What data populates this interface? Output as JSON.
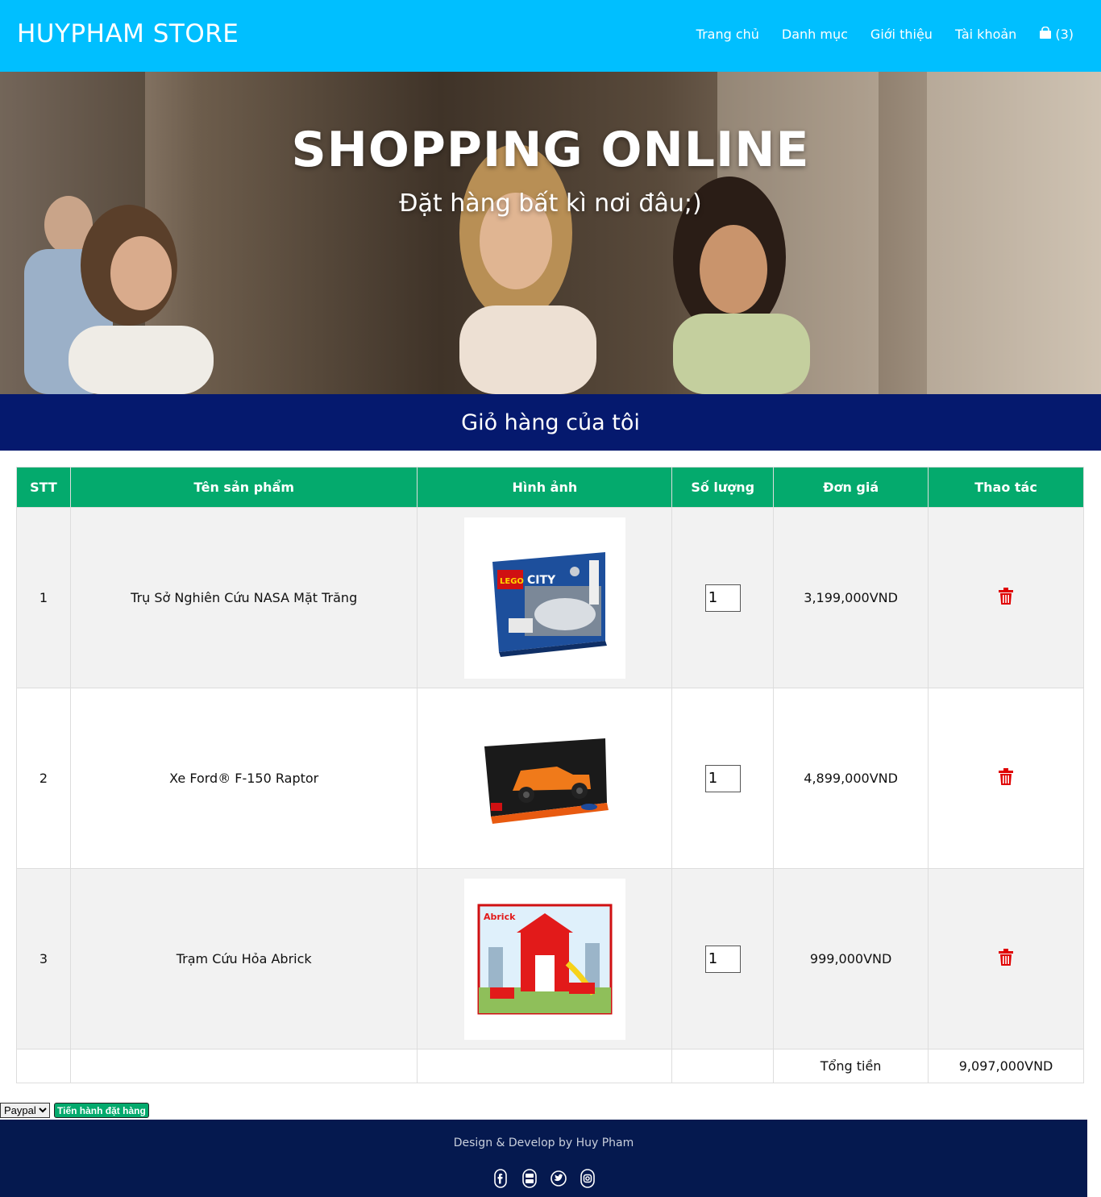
{
  "header": {
    "brand": "HUYPHAM STORE",
    "nav": [
      "Trang chủ",
      "Danh mục",
      "Giới thiệu",
      "Tài khoản"
    ],
    "cart_count": "(3)"
  },
  "hero": {
    "title": "SHOPPING ONLINE",
    "subtitle": "Đặt hàng bất kì nơi đâu;)"
  },
  "cart": {
    "heading": "Giỏ hàng của tôi",
    "columns": [
      "STT",
      "Tên sản phẩm",
      "Hình ảnh",
      "Số lượng",
      "Đơn giá",
      "Thao tác"
    ],
    "items": [
      {
        "stt": "1",
        "name": "Trụ Sở Nghiên Cứu NASA Mặt Trăng",
        "qty": "1",
        "price": "3,199,000VND",
        "image_icon": "lego-city-box-icon"
      },
      {
        "stt": "2",
        "name": "Xe Ford® F-150 Raptor",
        "qty": "1",
        "price": "4,899,000VND",
        "image_icon": "lego-technic-truck-box-icon"
      },
      {
        "stt": "3",
        "name": "Trạm Cứu Hỏa Abrick",
        "qty": "1",
        "price": "999,000VND",
        "image_icon": "abrick-fire-station-box-icon"
      }
    ],
    "total_label": "Tổng tiền",
    "total_value": "9,097,000VND"
  },
  "checkout": {
    "payment_selected": "Paypal",
    "submit_label": "Tiến hành đặt hàng"
  },
  "footer": {
    "credit": "Design & Develop by Huy Pham",
    "socials": [
      "facebook-icon",
      "youtube-icon",
      "twitter-icon",
      "instagram-icon"
    ]
  },
  "colors": {
    "header": "#00bfff",
    "band": "#05196e",
    "table_header": "#04aa6d",
    "delete": "#e00000",
    "footer": "#05194f"
  }
}
